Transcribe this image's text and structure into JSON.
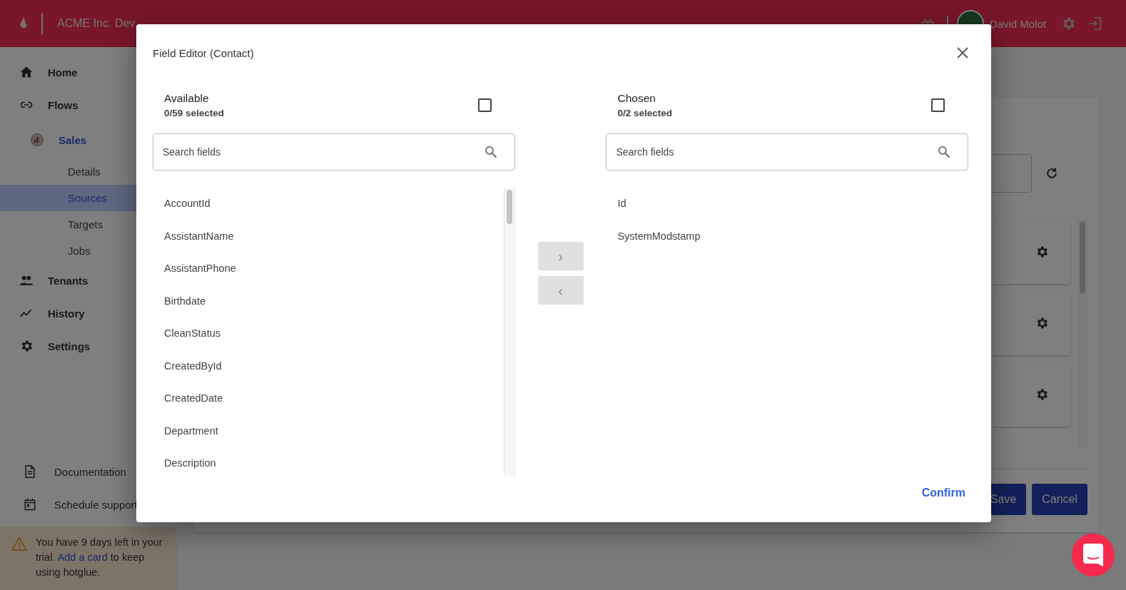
{
  "header": {
    "brand": "ACME Inc. Dev",
    "user": "David Molot"
  },
  "sidebar": {
    "items": [
      {
        "kind": "main",
        "label": "Home",
        "selected": false
      },
      {
        "kind": "main",
        "label": "Flows",
        "selected": false
      },
      {
        "kind": "flow",
        "label": "Sales",
        "selected": false
      },
      {
        "kind": "sub",
        "label": "Details",
        "selected": false
      },
      {
        "kind": "sub",
        "label": "Sources",
        "selected": true
      },
      {
        "kind": "sub",
        "label": "Targets",
        "selected": false
      },
      {
        "kind": "sub",
        "label": "Jobs",
        "selected": false
      },
      {
        "kind": "main",
        "label": "Tenants",
        "selected": false
      },
      {
        "kind": "main",
        "label": "History",
        "selected": false
      },
      {
        "kind": "main",
        "label": "Settings",
        "selected": false
      }
    ],
    "links": [
      {
        "label": "Documentation"
      },
      {
        "label": "Schedule support"
      }
    ],
    "trial": {
      "before": "You have 9 days left in your trial.",
      "link": "Add a card",
      "after": "to keep using hotglue."
    }
  },
  "main": {
    "buttons": [
      "Save",
      "Cancel"
    ]
  },
  "modal": {
    "title": "Field Editor (Contact)",
    "lists": [
      {
        "title": "Available",
        "count": "0/59 selected",
        "checked": false,
        "placeholder": "Search fields",
        "items": [
          "AccountId",
          "AssistantName",
          "AssistantPhone",
          "Birthdate",
          "CleanStatus",
          "CreatedById",
          "CreatedDate",
          "Department",
          "Description"
        ]
      },
      {
        "title": "Chosen",
        "count": "0/2 selected",
        "checked": false,
        "placeholder": "Search fields",
        "items": [
          "Id",
          "SystemModstamp"
        ]
      }
    ],
    "move_buttons": [
      {
        "symbol": "›"
      },
      {
        "symbol": "‹"
      }
    ],
    "confirm": "Confirm"
  }
}
